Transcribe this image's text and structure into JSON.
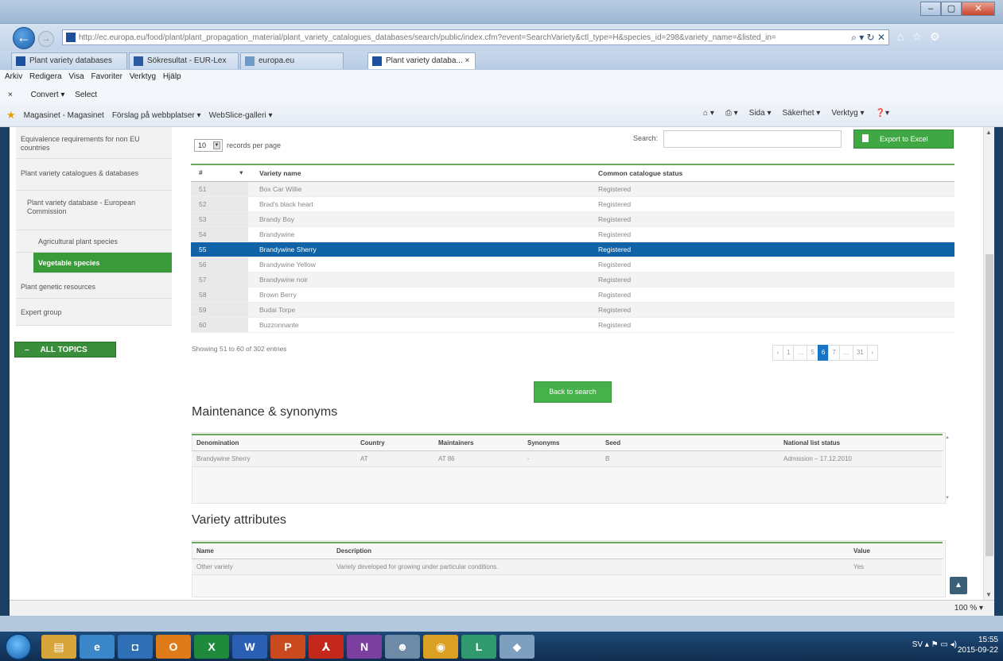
{
  "browser": {
    "url": "http://ec.europa.eu/food/plant/plant_propagation_material/plant_variety_catalogues_databases/search/public/index.cfm?event=SearchVariety&ctl_type=H&species_id=298&variety_name=&listed_in=",
    "tabs": [
      "Plant variety databases",
      "Sökresultat - EUR-Lex",
      "europa.eu",
      "Plant variety databa..."
    ],
    "menu": [
      "Arkiv",
      "Redigera",
      "Visa",
      "Favoriter",
      "Verktyg",
      "Hjälp"
    ],
    "toolbar": [
      "Convert",
      "Select"
    ],
    "favorites": [
      "Magasinet - Magasinet",
      "Förslag på webbplatser",
      "WebSlice-galleri"
    ],
    "command_bar": [
      "Sida",
      "Säkerhet",
      "Verktyg"
    ],
    "zoom": "100 %"
  },
  "sidebar": {
    "items": [
      "Equivalence requirements for non EU countries",
      "Plant variety catalogues & databases",
      "Plant variety database - European Commission",
      "Agricultural plant species",
      "Vegetable species",
      "Plant genetic resources",
      "Expert group"
    ],
    "all_topics": "ALL TOPICS"
  },
  "table_controls": {
    "page_length": "10",
    "length_label": "records per page",
    "search_label": "Search:",
    "search_value": "",
    "export_label": "Export to Excel"
  },
  "variety_table": {
    "headers": [
      "#",
      "Variety name",
      "Common catalogue status"
    ],
    "rows": [
      {
        "num": "51",
        "name": "Box Car Willie",
        "status": "Registered"
      },
      {
        "num": "52",
        "name": "Brad's black heart",
        "status": "Registered"
      },
      {
        "num": "53",
        "name": "Brandy Boy",
        "status": "Registered"
      },
      {
        "num": "54",
        "name": "Brandywine",
        "status": "Registered"
      },
      {
        "num": "55",
        "name": "Brandywine Sherry",
        "status": "Registered"
      },
      {
        "num": "56",
        "name": "Brandywine Yellow",
        "status": "Registered"
      },
      {
        "num": "57",
        "name": "Brandywine noir",
        "status": "Registered"
      },
      {
        "num": "58",
        "name": "Brown Berry",
        "status": "Registered"
      },
      {
        "num": "59",
        "name": "Budai Torpe",
        "status": "Registered"
      },
      {
        "num": "60",
        "name": "Buzzonnante",
        "status": "Registered"
      }
    ],
    "info": "Showing 51 to 60 of 302 entries",
    "pages": [
      "‹",
      "1",
      "…",
      "5",
      "6",
      "7",
      "…",
      "31",
      "›"
    ],
    "active_page": "6"
  },
  "back_button": "Back to search",
  "maintenance": {
    "title": "Maintenance & synonyms",
    "headers": [
      "Denomination",
      "Country",
      "Maintainers",
      "Synonyms",
      "Seed",
      "National list status"
    ],
    "row": [
      "Brandywine Sherry",
      "AT",
      "AT 86",
      "-",
      "B",
      "Admission – 17.12.2010"
    ]
  },
  "attributes": {
    "title": "Variety attributes",
    "headers": [
      "Name",
      "Description",
      "Value"
    ],
    "row": [
      "Other variety",
      "Variety developed for growing under particular conditions.",
      "Yes"
    ]
  },
  "taskbar": {
    "language": "SV",
    "time": "15:55",
    "date": "2015-09-22"
  }
}
